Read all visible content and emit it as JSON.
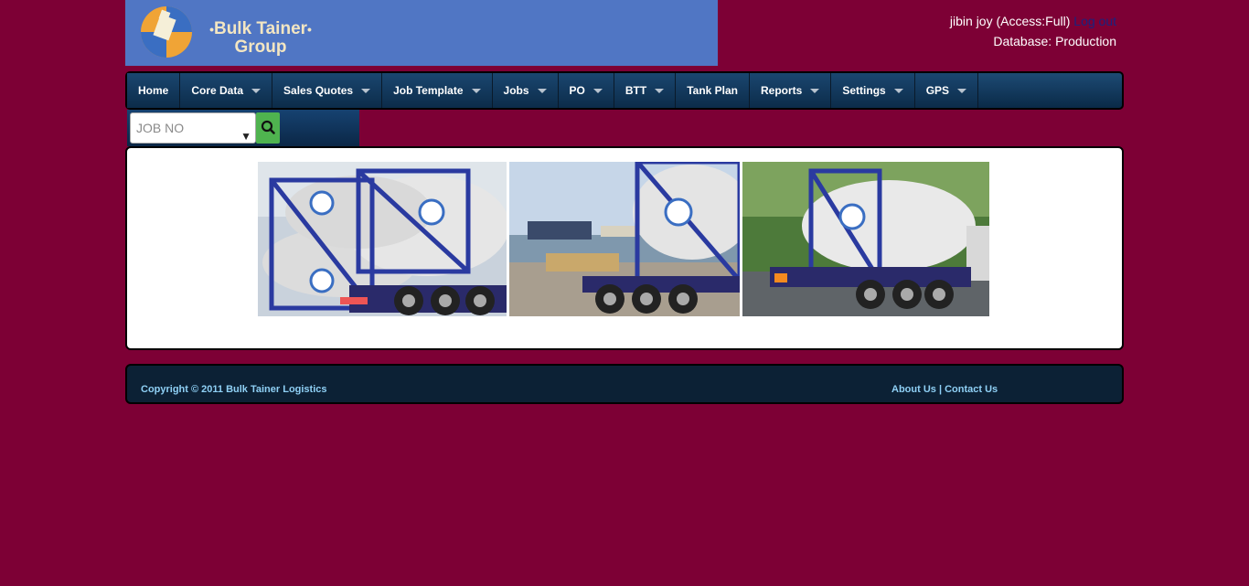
{
  "brand": {
    "line1": "Bulk Tainer",
    "line2": "Group",
    "dot": "•",
    "colors": {
      "banner": "#5076c4",
      "page": "#7d0035",
      "nav": "#0c2c4a"
    }
  },
  "user": {
    "name_access": "jibin joy (Access:Full)",
    "logout": "Log out",
    "database": "Database: Production"
  },
  "nav": {
    "items": [
      {
        "label": "Home",
        "dropdown": false
      },
      {
        "label": "Core Data",
        "dropdown": true
      },
      {
        "label": "Sales Quotes",
        "dropdown": true
      },
      {
        "label": "Job Template",
        "dropdown": true
      },
      {
        "label": "Jobs",
        "dropdown": true
      },
      {
        "label": "PO",
        "dropdown": true
      },
      {
        "label": "BTT",
        "dropdown": true
      },
      {
        "label": "Tank Plan",
        "dropdown": false
      },
      {
        "label": "Reports",
        "dropdown": true
      },
      {
        "label": "Settings",
        "dropdown": true
      },
      {
        "label": "GPS",
        "dropdown": true
      }
    ]
  },
  "search": {
    "selected": "JOB NO",
    "button_icon": "search-icon"
  },
  "footer": {
    "copyright": "Copyright © 2011 Bulk Tainer Logistics",
    "about": "About Us",
    "separator": "|",
    "contact": "Contact Us"
  }
}
